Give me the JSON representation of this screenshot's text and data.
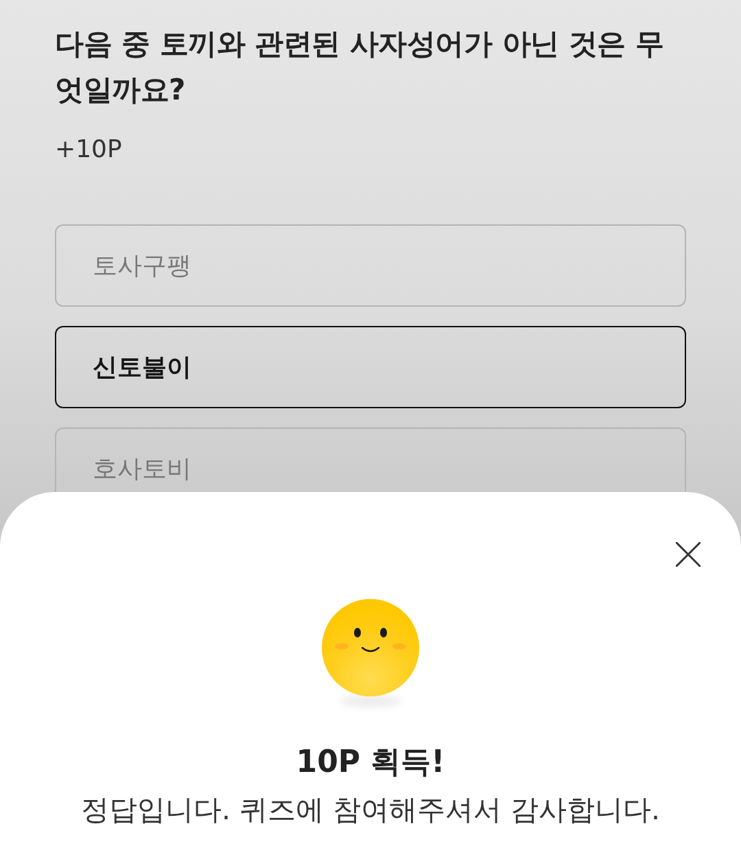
{
  "question": {
    "title": "다음 중 토끼와 관련된 사자성어가 아닌 것은 무엇일까요?",
    "points": "+10P"
  },
  "options": [
    {
      "label": "토사구팽",
      "selected": false
    },
    {
      "label": "신토불이",
      "selected": true
    },
    {
      "label": "호사토비",
      "selected": false
    }
  ],
  "result_sheet": {
    "title": "10P 획득!",
    "message": "정답입니다. 퀴즈에 참여해주셔서 감사합니다."
  }
}
